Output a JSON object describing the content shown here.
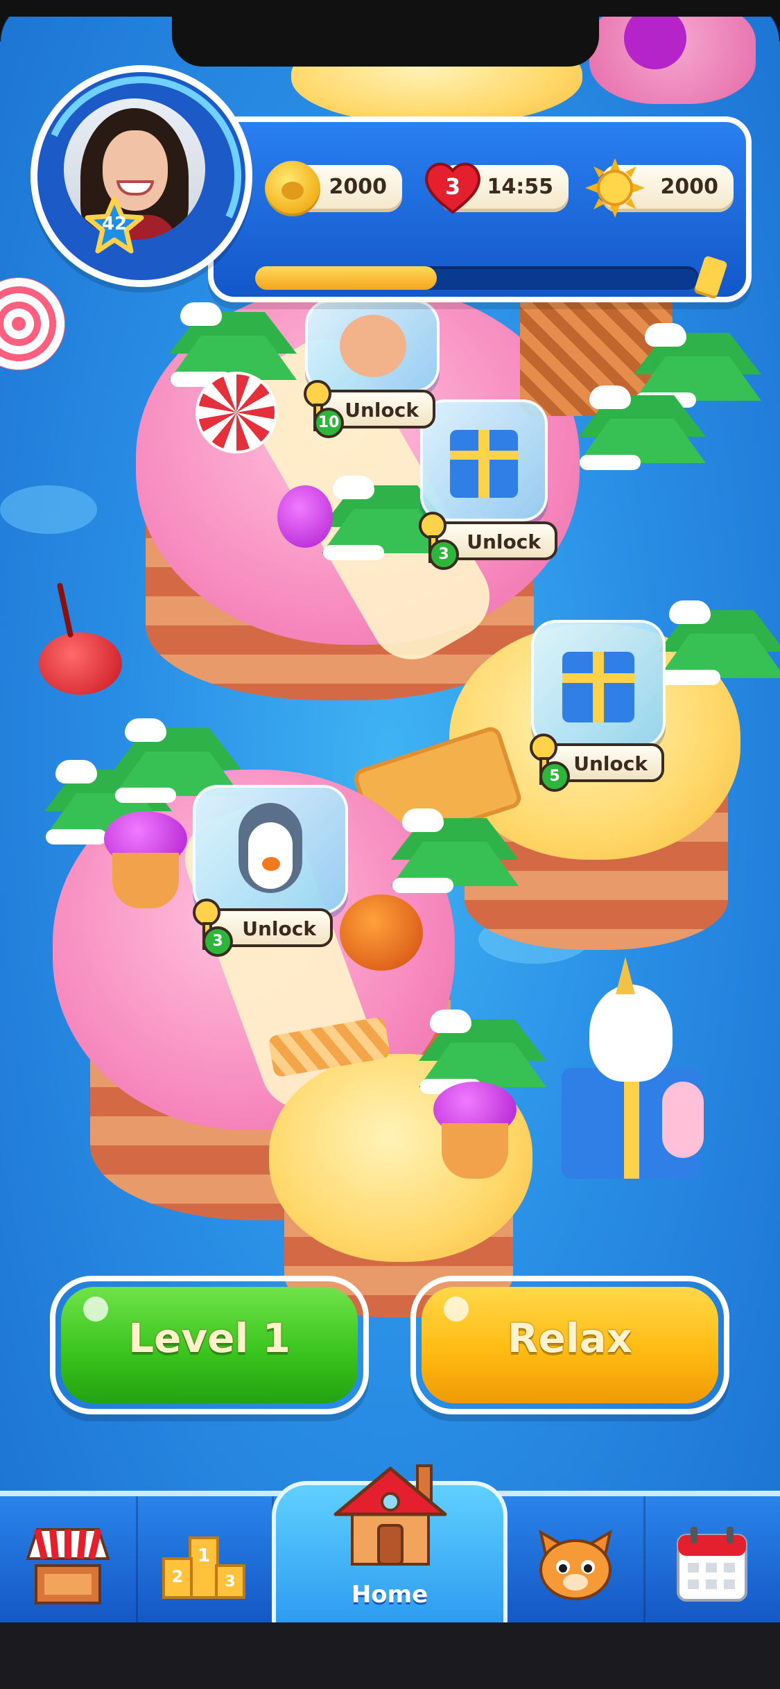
{
  "player": {
    "level": "42",
    "xp_progress_fraction": 0.41
  },
  "stats": {
    "coins": "2000",
    "lives": "3",
    "life_timer": "14:55",
    "suns": "2000"
  },
  "map": {
    "unlocks": [
      {
        "label": "Unlock",
        "keys": "10",
        "reward": "hamster"
      },
      {
        "label": "Unlock",
        "keys": "3",
        "reward": "gift"
      },
      {
        "label": "Unlock",
        "keys": "5",
        "reward": "gift"
      },
      {
        "label": "Unlock",
        "keys": "3",
        "reward": "penguin"
      }
    ]
  },
  "actions": {
    "level_button": "Level 1",
    "relax_button": "Relax"
  },
  "nav": {
    "items": [
      {
        "icon": "shop-stall-icon"
      },
      {
        "icon": "leaderboard-podium-icon"
      },
      {
        "icon": "house-icon",
        "label": "Home",
        "active": true
      },
      {
        "icon": "cat-icon"
      },
      {
        "icon": "calendar-icon"
      }
    ]
  },
  "colors": {
    "sea": "#2a8fe6",
    "green_button": "#3cc51f",
    "yellow_button": "#ffbb12",
    "panel_blue": "#1357c9"
  }
}
